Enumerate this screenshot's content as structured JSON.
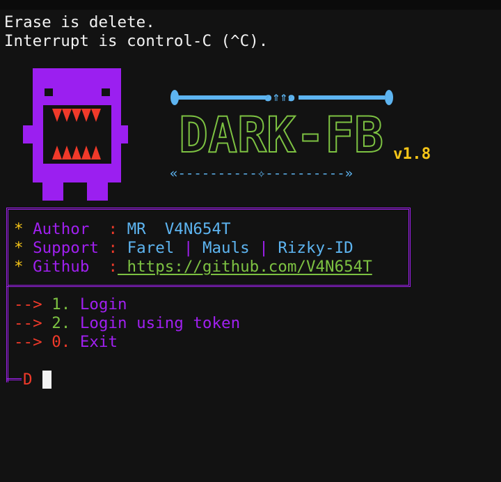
{
  "terminal": {
    "line1": "Erase is delete.",
    "line2": "Interrupt is control-C (^C)."
  },
  "banner": {
    "title": "DARK-FB",
    "version": "v1.8",
    "top_ornament": "๑⇑⇑๑",
    "bottom_ornament": "«----------✧----------»"
  },
  "info": {
    "bullet": "*",
    "author_label": "Author ",
    "author_sep": ":",
    "author_value": "MR  V4N654T",
    "support_label": "Support",
    "support_sep": ":",
    "support_values": [
      "Farel",
      "Mauls",
      "Rizky-ID"
    ],
    "support_divider": "|",
    "github_label": "Github ",
    "github_sep": ":",
    "github_value": " https://github.com/V4N654T"
  },
  "menu": {
    "arrow": "-->",
    "items": [
      {
        "number": "1.",
        "label": "Login"
      },
      {
        "number": "2.",
        "label": "Login using token"
      },
      {
        "number": "0.",
        "label": "Exit"
      }
    ]
  },
  "prompt": {
    "text": "D"
  },
  "colors": {
    "background": "#121212",
    "purple": "#a020f0",
    "blue": "#5db4f0",
    "green": "#7dc242",
    "yellow": "#f5c518",
    "red": "#f03a2a"
  }
}
